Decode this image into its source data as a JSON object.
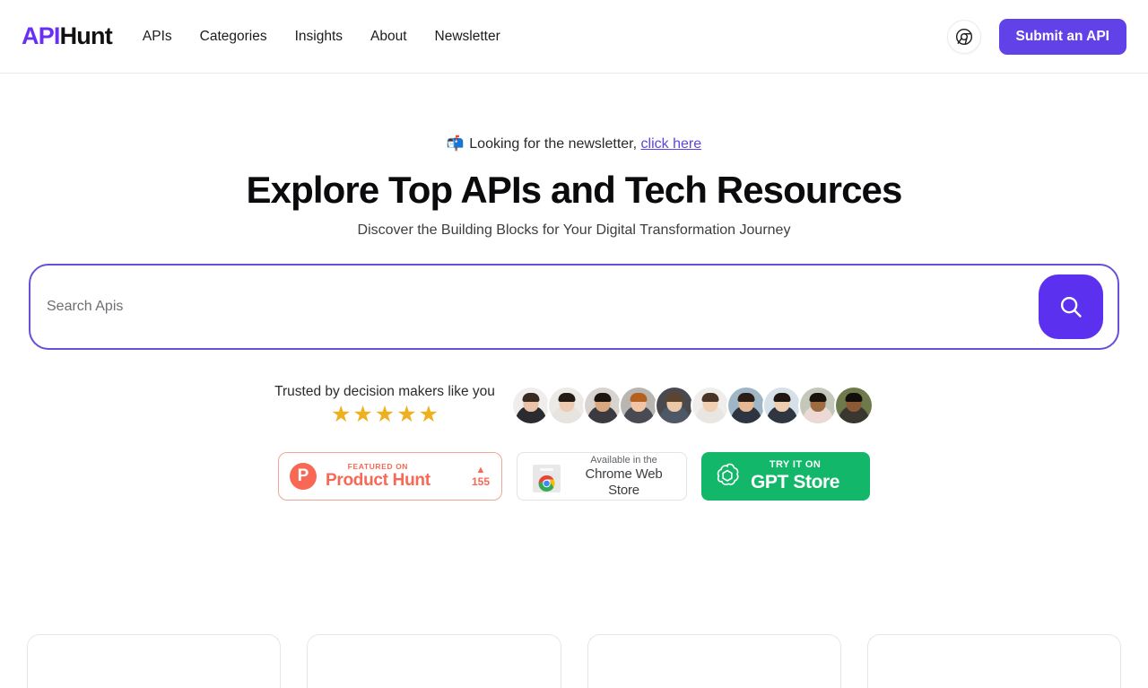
{
  "header": {
    "logo": {
      "part1": "API",
      "part2": "Hunt",
      "color1": "#6a2ff0",
      "color2": "#111111"
    },
    "nav": [
      {
        "label": "APIs",
        "name": "nav-apis"
      },
      {
        "label": "Categories",
        "name": "nav-categories"
      },
      {
        "label": "Insights",
        "name": "nav-insights"
      },
      {
        "label": "About",
        "name": "nav-about"
      },
      {
        "label": "Newsletter",
        "name": "nav-newsletter"
      }
    ],
    "chrome_icon": "chrome-extension-icon",
    "submit_label": "Submit an API",
    "submit_color": "#6141e8"
  },
  "hero": {
    "newsletter_emoji": "📬",
    "newsletter_text": "Looking for the newsletter,",
    "newsletter_link": "click here",
    "title": "Explore Top APIs and Tech Resources",
    "subtitle": "Discover the Building Blocks for Your Digital Transformation Journey"
  },
  "search": {
    "placeholder": "Search Apis",
    "value": "",
    "button_icon": "search-icon",
    "border_color": "#6b4fd8",
    "button_color": "#5b30ee"
  },
  "trust": {
    "text": "Trusted by decision makers like you",
    "stars": 5,
    "star_glyph": "★",
    "star_color": "#efb01e",
    "avatar_count": 10,
    "avatars": [
      {
        "skin": "#e8c3a8",
        "hair": "#3b2a22",
        "shirt": "#2b2b30",
        "bg": "#f0eeec"
      },
      {
        "skin": "#edcbb0",
        "hair": "#241a15",
        "shirt": "#e7e3df",
        "bg": "#eceae7"
      },
      {
        "skin": "#d9a87f",
        "hair": "#1d1410",
        "shirt": "#3a3a40",
        "bg": "#d7d3cf"
      },
      {
        "skin": "#f0c4a4",
        "hair": "#b4611f",
        "shirt": "#4a4a52",
        "bg": "#b9b5b1"
      },
      {
        "skin": "#ecc8ab",
        "hair": "#5c4430",
        "shirt": "#4e5866",
        "bg": "#4a4a4e"
      },
      {
        "skin": "#f1cfb3",
        "hair": "#4a3425",
        "shirt": "#e9e6e2",
        "bg": "#efeeec"
      },
      {
        "skin": "#e6b996",
        "hair": "#2a1d16",
        "shirt": "#2f3540",
        "bg": "#9fb6c6"
      },
      {
        "skin": "#eecdb0",
        "hair": "#201713",
        "shirt": "#30363f",
        "bg": "#d6e0e8"
      },
      {
        "skin": "#9f6b43",
        "hair": "#1a120d",
        "shirt": "#ecd9d6",
        "bg": "#c3c8bb"
      },
      {
        "skin": "#8a5a34",
        "hair": "#140e0a",
        "shirt": "#3a3630",
        "bg": "#6f7a4c"
      }
    ]
  },
  "badges": {
    "product_hunt": {
      "icon": "product-hunt-icon",
      "letter": "P",
      "small": "FEATURED ON",
      "big": "Product Hunt",
      "upvote_icon": "▲",
      "count": "155",
      "color": "#f96855"
    },
    "chrome_web_store": {
      "icon": "chrome-web-store-icon",
      "small": "Available in the",
      "big": "Chrome Web Store"
    },
    "gpt_store": {
      "icon": "openai-icon",
      "small": "TRY IT ON",
      "big": "GPT Store",
      "color": "#12b76a"
    }
  },
  "cards": [
    {
      "name": "api-card-1"
    },
    {
      "name": "api-card-2"
    },
    {
      "name": "api-card-3"
    },
    {
      "name": "api-card-4"
    }
  ]
}
